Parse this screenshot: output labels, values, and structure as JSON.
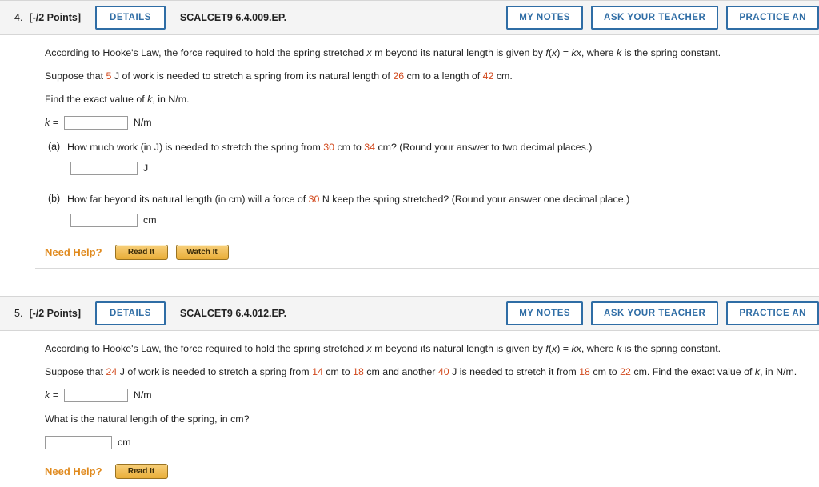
{
  "problems": [
    {
      "number": "4.",
      "points": "[-/2 Points]",
      "details_label": "DETAILS",
      "code": "SCALCET9 6.4.009.EP.",
      "buttons": {
        "my_notes": "MY NOTES",
        "ask_teacher": "ASK YOUR TEACHER",
        "practice": "PRACTICE AN"
      },
      "intro_a": "According to Hooke's Law, the force required to hold the spring stretched ",
      "intro_x": "x",
      "intro_b": " m beyond its natural length is given by ",
      "intro_f": "f",
      "intro_c": "(",
      "intro_x2": "x",
      "intro_d": ") = ",
      "intro_k": "k",
      "intro_e": "x",
      "intro_f2": ", where ",
      "intro_k2": "k",
      "intro_g": " is the spring constant.",
      "suppose_pre": "Suppose that ",
      "suppose_work": "5",
      "suppose_mid1": " J of work is needed to stretch a spring from its natural length of ",
      "suppose_nat": "26",
      "suppose_mid2": " cm to a length of ",
      "suppose_len": "42",
      "suppose_end": " cm.",
      "find_pre": "Find the exact value of ",
      "find_k": "k",
      "find_post": ", in N/m.",
      "k_label": "k =",
      "k_unit": "N/m",
      "parts": [
        {
          "letter": "(a)",
          "text_pre": "How much work (in J) is needed to stretch the spring from ",
          "v1": "30",
          "text_mid": " cm to ",
          "v2": "34",
          "text_post": " cm? (Round your answer to two decimal places.)",
          "unit": "J"
        },
        {
          "letter": "(b)",
          "text_pre": "How far beyond its natural length (in cm) will a force of ",
          "v1": "30",
          "text_mid": " N keep the spring stretched? (Round your answer one decimal place.)",
          "v2": "",
          "text_post": "",
          "unit": "cm"
        }
      ],
      "need_help_label": "Need Help?",
      "help_buttons": [
        "Read It",
        "Watch It"
      ]
    },
    {
      "number": "5.",
      "points": "[-/2 Points]",
      "details_label": "DETAILS",
      "code": "SCALCET9 6.4.012.EP.",
      "buttons": {
        "my_notes": "MY NOTES",
        "ask_teacher": "ASK YOUR TEACHER",
        "practice": "PRACTICE AN"
      },
      "intro_a": "According to Hooke's Law, the force required to hold the spring stretched ",
      "intro_x": "x",
      "intro_b": " m beyond its natural length is given by ",
      "intro_f": "f",
      "intro_c": "(",
      "intro_x2": "x",
      "intro_d": ") = ",
      "intro_k": "k",
      "intro_e": "x",
      "intro_f2": ", where ",
      "intro_k2": "k",
      "intro_g": " is the spring constant.",
      "suppose_pre": "Suppose that ",
      "suppose_w1": "24",
      "suppose_s1": " J of work is needed to stretch a spring from ",
      "suppose_v1": "14",
      "suppose_s2": " cm to ",
      "suppose_v2": "18",
      "suppose_s3": " cm and another ",
      "suppose_w2": "40",
      "suppose_s4": " J is needed to stretch it from ",
      "suppose_v3": "18",
      "suppose_s5": " cm to ",
      "suppose_v4": "22",
      "suppose_s6": " cm. Find the exact value of ",
      "suppose_k": "k",
      "suppose_s7": ", in N/m.",
      "k_label": "k =",
      "k_unit": "N/m",
      "question": "What is the natural length of the spring, in cm?",
      "answer_unit": "cm",
      "need_help_label": "Need Help?",
      "help_buttons": [
        "Read It"
      ]
    }
  ]
}
